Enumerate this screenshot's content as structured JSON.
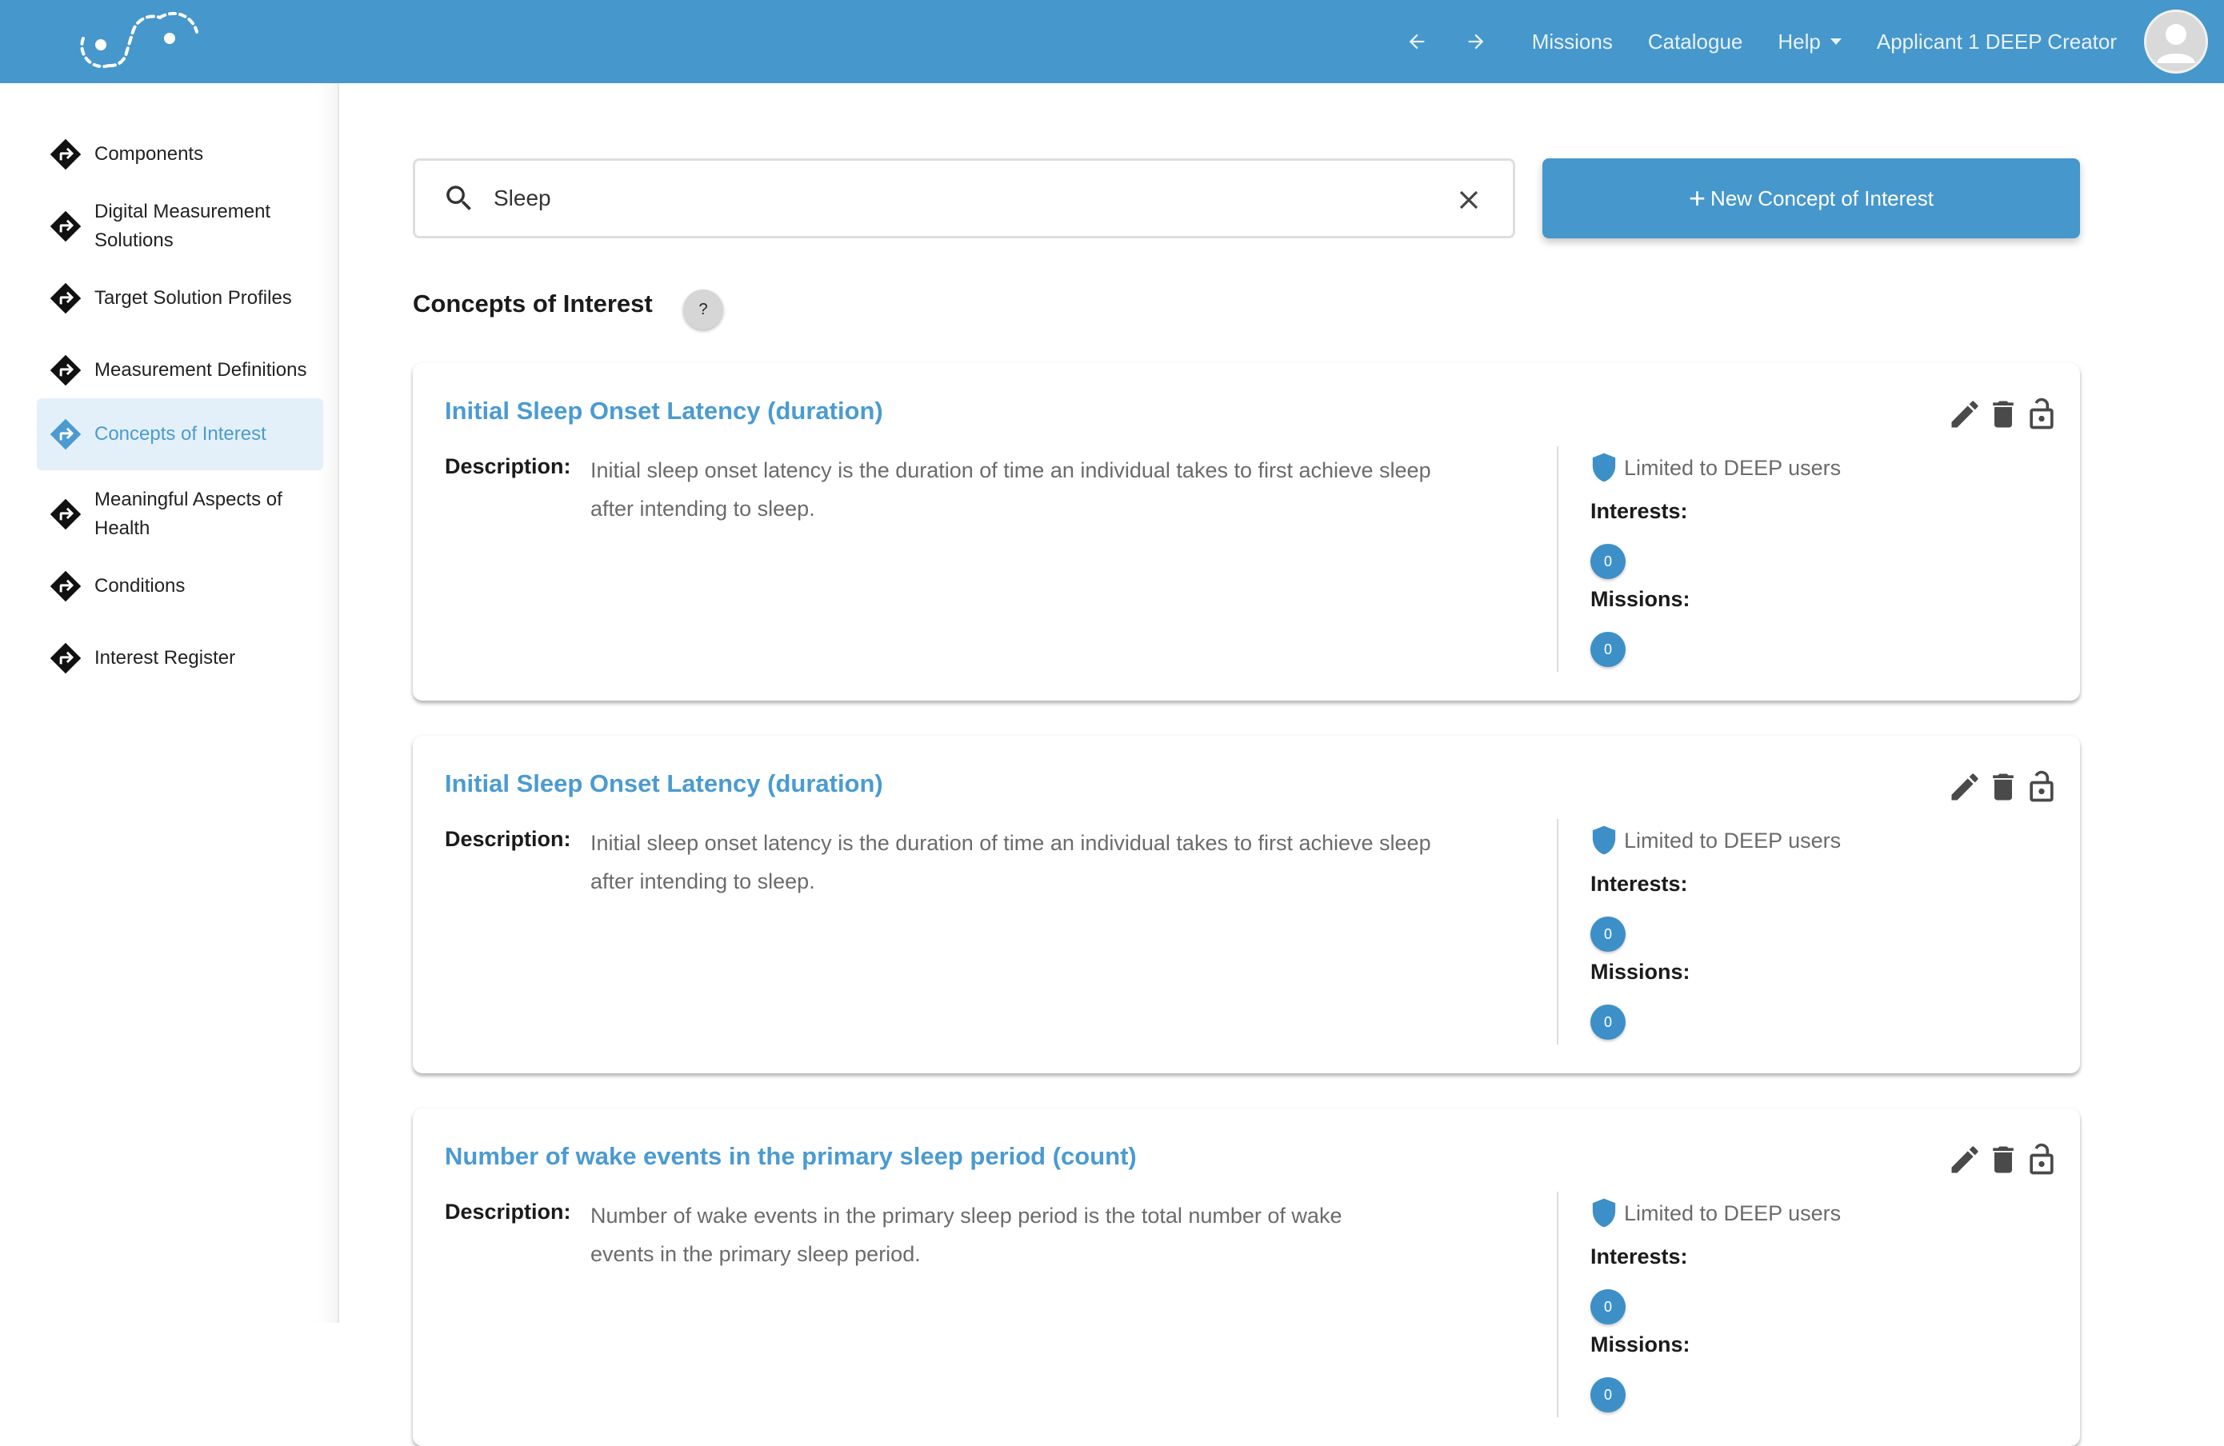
{
  "header": {
    "nav": [
      {
        "label": "Missions"
      },
      {
        "label": "Catalogue"
      },
      {
        "label": "Help"
      }
    ],
    "user_name": "Applicant 1 DEEP Creator",
    "icons": [
      "logo",
      "arrow-left-icon",
      "arrow-right-icon",
      "caret-down-icon",
      "avatar"
    ]
  },
  "sidebar": {
    "items": [
      {
        "label": "Components"
      },
      {
        "label": "Digital Measurement Solutions"
      },
      {
        "label": "Target Solution Profiles"
      },
      {
        "label": "Measurement Definitions"
      },
      {
        "label": "Concepts of Interest",
        "active": true
      },
      {
        "label": "Meaningful Aspects of Health"
      },
      {
        "label": "Conditions"
      },
      {
        "label": "Interest Register"
      }
    ],
    "icon": "directions-diamond-icon"
  },
  "search": {
    "value": "Sleep"
  },
  "new_button": {
    "label": "New Concept of Interest",
    "icon": "+"
  },
  "section": {
    "title": "Concepts of Interest",
    "help_label": "?"
  },
  "labels": {
    "description": "Description:",
    "access": "Limited to DEEP users",
    "interests": "Interests:",
    "missions": "Missions:"
  },
  "cards": [
    {
      "title": "Initial Sleep Onset Latency (duration)",
      "description": "Initial sleep onset latency is the duration of time an individual takes to first achieve sleep after intending to sleep.",
      "interests": "0",
      "missions": "0"
    },
    {
      "title": "Initial Sleep Onset Latency (duration)",
      "description": "Initial sleep onset latency is the duration of time an individual takes to first achieve sleep after intending to sleep.",
      "interests": "0",
      "missions": "0"
    },
    {
      "title": "Number of wake events in the primary sleep period (count)",
      "description": "Number of wake events in the primary sleep period is the total number of wake events in the primary sleep period.",
      "interests": "0",
      "missions": "0"
    }
  ],
  "colors": {
    "brand": "#4597cc",
    "link": "#4a9bd1",
    "badge": "#3d8fc8"
  }
}
